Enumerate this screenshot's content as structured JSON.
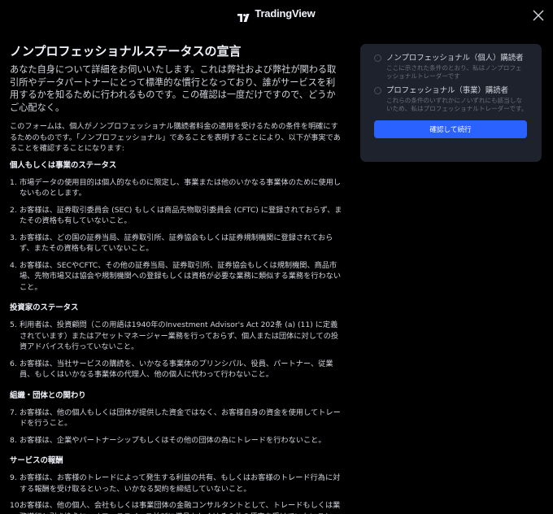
{
  "header": {
    "logo_text": "TradingView"
  },
  "content": {
    "title": "ノンプロフェッショナルステータスの宣言",
    "intro": "あなた自身について詳細をお伺いいたします。これは弊社および弊社が関わる取引所やデータパートナーにとって標準的な慣行となっており、誰がサービスを利用するかを知るために行われるものです。この確認は一度だけですので、どうかご心配なく。",
    "form_note": "このフォームは、個人がノンプロフェッショナル購読者料金の適用を受けるための条件を明確にするためのものです。「ノンプロフェッショナル」であることを表明することにより、以下が事実であることを確認することになります:",
    "sections": [
      {
        "heading": "個人もしくは事業のステータス",
        "items": [
          {
            "num": "1.",
            "text": "市場データの使用目的は個人的なものに限定し、事業または他のいかなる事業体のために使用しないものとします。"
          },
          {
            "num": "2.",
            "text": "お客様は、証券取引委員会 (SEC) もしくは商品先物取引委員会 (CFTC) に登録されておらず、またその資格も有していないこと。"
          },
          {
            "num": "3.",
            "text": "お客様は、どの国の証券当局、証券取引所、証券協会もしくは証券規制機関に登録されておらず、またその資格も有していないこと。"
          },
          {
            "num": "4.",
            "text": "お客様は、SECやCFTC、その他の証券当局、証券取引所、証券協会もしくは規制機関、商品市場、先物市場又は協会や規制機関への登録もしくは資格が必要な業務に類似する業務を行わないこと。"
          }
        ]
      },
      {
        "heading": "投資家のステータス",
        "items": [
          {
            "num": "5.",
            "text": "利用者は、投資顧問（この用語は1940年のInvestment Advisor's Act 202条 (a) (11) に定義されています）またはアセットマネージャー業務を行っておらず、個人または団体に対しての投資アドバイスも行っていないこと。"
          },
          {
            "num": "6.",
            "text": "お客様は、当社サービスの購読を、いかなる事業体のプリンシパル、役員、パートナー、従業員、もしくはいかなる事業体の代理人、他の個人に代わって行わないこと。"
          }
        ]
      },
      {
        "heading": "組織・団体との関わり",
        "items": [
          {
            "num": "7.",
            "text": "お客様は、他の個人もしくは団体が提供した資金ではなく、お客様自身の資金を使用してトレードを行うこと。"
          },
          {
            "num": "8.",
            "text": "お客様は、企業やパートナーシップもしくはその他の団体の為にトレードを行わないこと。"
          }
        ]
      },
      {
        "heading": "サービスの報酬",
        "items": [
          {
            "num": "9.",
            "text": "お客様は、お客様のトレードによって発生する利益の共有、もしくはお客様のトレード行為に対する報酬を受け取るといった、いかなる契約を締結していないこと。"
          },
          {
            "num": "10.",
            "text": "お客様は、他の個人、会社もしくは事業団体の金融コンサルタントとして、トレードもしくは業務遂行と引き換えに、オフィススペース並びに備品もしくはその他の便宜を受けていないこと。"
          }
        ]
      }
    ]
  },
  "panel": {
    "options": [
      {
        "title": "ノンプロフェッショナル（個人）購読者",
        "desc": "ここに示された条件のとおり、私はノンプロフェッショナルトレーダーです"
      },
      {
        "title": "プロフェッショナル（事業）購読者",
        "desc": "これらの条件のいずれかにノいずれにも該当しないため、私はプロフェッショナルトレーダーです。"
      }
    ],
    "confirm_label": "確認して続行"
  },
  "colors": {
    "background": "#000000",
    "panel": "#1e222d",
    "accent": "#2962ff",
    "text": "#d1d4dc",
    "muted": "#6a6d78"
  },
  "icons": {
    "logo": "tradingview-logo-icon",
    "close": "close-icon",
    "radio": "radio-unchecked-icon"
  }
}
